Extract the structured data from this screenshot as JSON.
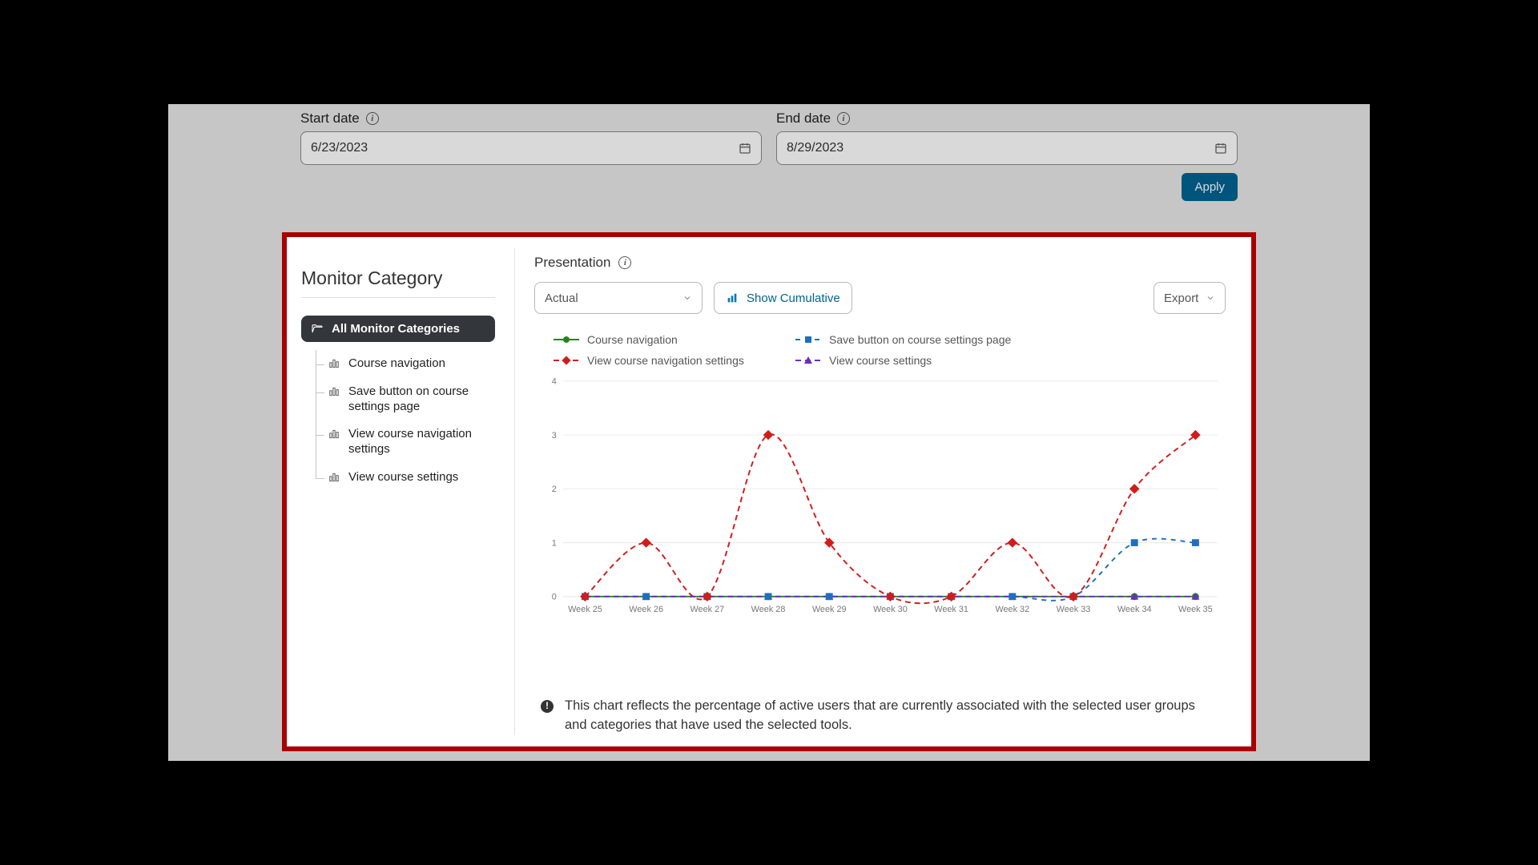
{
  "filters": {
    "start_label": "Start date",
    "end_label": "End date",
    "start_value": "6/23/2023",
    "end_value": "8/29/2023",
    "apply_label": "Apply"
  },
  "sidebar": {
    "title": "Monitor Category",
    "root_label": "All Monitor Categories",
    "items": [
      {
        "label": "Course navigation"
      },
      {
        "label": "Save button on course settings page"
      },
      {
        "label": "View course navigation settings"
      },
      {
        "label": "View course settings"
      }
    ]
  },
  "main": {
    "presentation_label": "Presentation",
    "mode_value": "Actual",
    "show_cumulative_label": "Show Cumulative",
    "export_label": "Export"
  },
  "note": "This chart reflects the percentage of active users that are currently associated with the selected user groups and categories that have used the selected tools.",
  "chart_data": {
    "type": "line",
    "categories": [
      "Week 25",
      "Week 26",
      "Week 27",
      "Week 28",
      "Week 29",
      "Week 30",
      "Week 31",
      "Week 32",
      "Week 33",
      "Week 34",
      "Week 35"
    ],
    "ylim": [
      0,
      4
    ],
    "yticks": [
      0,
      1,
      2,
      3,
      4
    ],
    "series": [
      {
        "name": "Course navigation",
        "color": "#1c891f",
        "marker": "circle",
        "dash": "none",
        "values": [
          0,
          0,
          0,
          0,
          0,
          0,
          0,
          0,
          0,
          0,
          0
        ]
      },
      {
        "name": "Save button on course settings page",
        "color": "#1f6fbf",
        "marker": "square",
        "dash": "6,6",
        "values": [
          0,
          0,
          0,
          0,
          0,
          0,
          0,
          0,
          0,
          1,
          1
        ]
      },
      {
        "name": "View course navigation settings",
        "color": "#d21c1c",
        "marker": "diamond",
        "dash": "7,5",
        "values": [
          0,
          1,
          0,
          3,
          1,
          0,
          0,
          1,
          0,
          2,
          3
        ]
      },
      {
        "name": "View course settings",
        "color": "#6b2fbf",
        "marker": "triangle",
        "dash": "7,5",
        "values": [
          0,
          0,
          0,
          0,
          0,
          0,
          0,
          0,
          0,
          0,
          0
        ]
      }
    ]
  }
}
